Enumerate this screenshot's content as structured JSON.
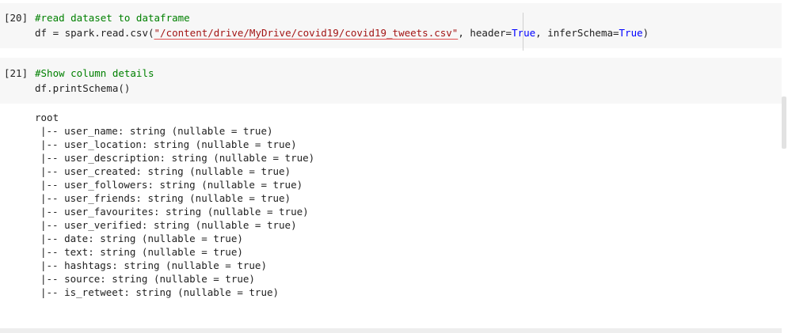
{
  "cells": [
    {
      "prompt": "[20]",
      "comment": "#read dataset to dataframe",
      "code_prefix": "df = spark.read.csv(",
      "path_string": "\"/content/drive/MyDrive/covid19/covid19_tweets.csv\"",
      "arg1_name": ", header=",
      "arg1_value": "True",
      "arg2_name": ", inferSchema=",
      "arg2_value": "True",
      "code_suffix": ")"
    },
    {
      "prompt": "[21]",
      "comment": "#Show column details",
      "code": "df.printSchema()"
    }
  ],
  "output": {
    "root": "root",
    "lines": [
      "|-- user_name: string (nullable = true)",
      "|-- user_location: string (nullable = true)",
      "|-- user_description: string (nullable = true)",
      "|-- user_created: string (nullable = true)",
      "|-- user_followers: string (nullable = true)",
      "|-- user_friends: string (nullable = true)",
      "|-- user_favourites: string (nullable = true)",
      "|-- user_verified: string (nullable = true)",
      "|-- date: string (nullable = true)",
      "|-- text: string (nullable = true)",
      "|-- hashtags: string (nullable = true)",
      "|-- source: string (nullable = true)",
      "|-- is_retweet: string (nullable = true)"
    ]
  },
  "colors": {
    "comment": "#008000",
    "string": "#a31515",
    "keyword": "#0000ff",
    "cell_bg": "#f7f7f7"
  }
}
